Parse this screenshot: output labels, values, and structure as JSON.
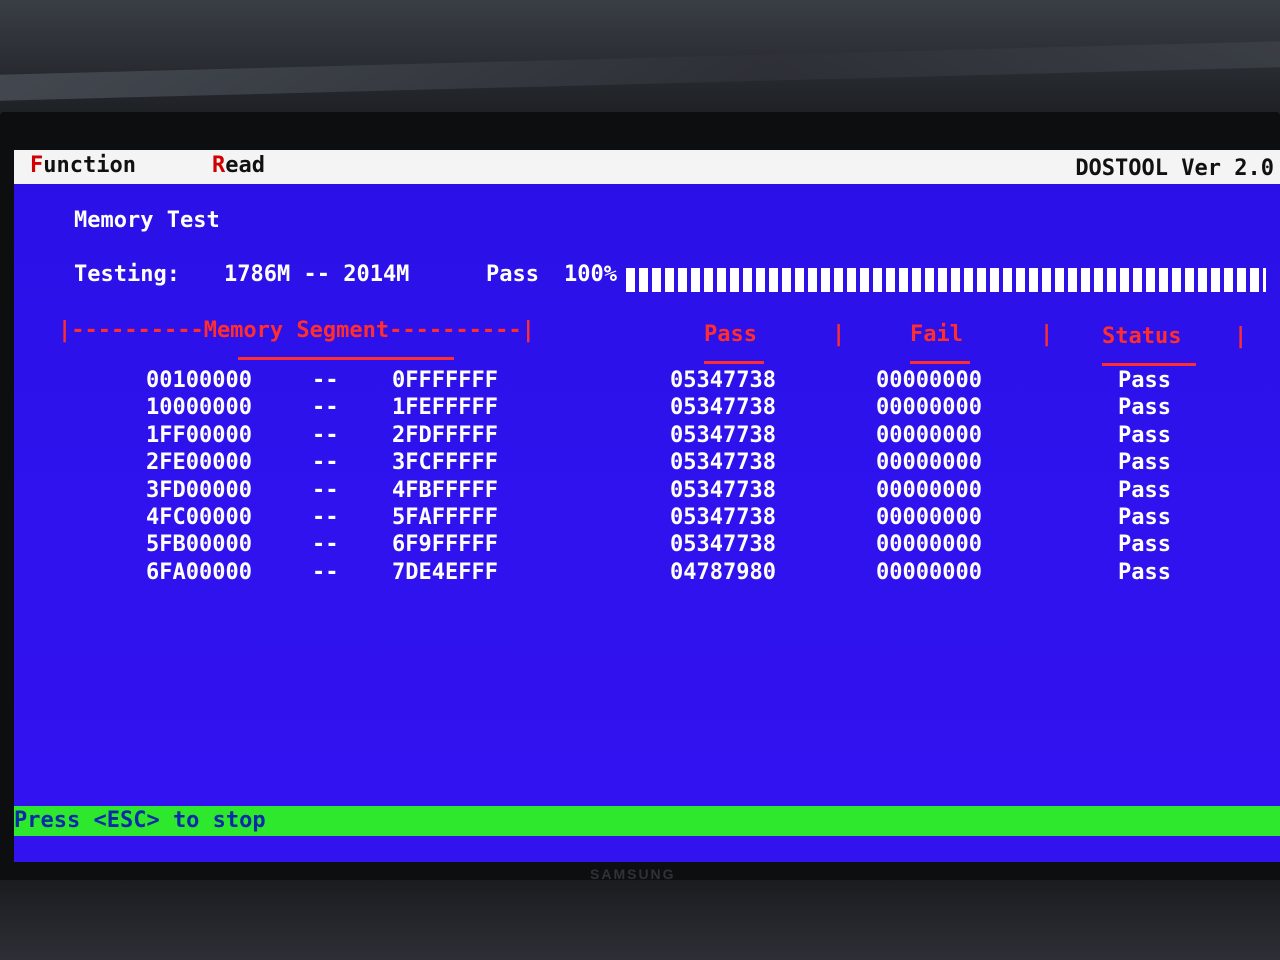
{
  "menubar": {
    "function_hot": "F",
    "function_rest": "unction",
    "read_hot": "R",
    "read_rest": "ead",
    "version": "DOSTOOL Ver 2.0"
  },
  "test": {
    "title": "Memory Test",
    "testing_label": "Testing:",
    "range": "1786M -- 2014M",
    "pass_label": "Pass",
    "progress_text": "100%",
    "progress_fraction": 1.0
  },
  "table": {
    "headers": {
      "segment": "|----------Memory Segment----------|",
      "pass": "Pass",
      "fail": "Fail",
      "status": "Status"
    },
    "separator": "|",
    "range_sep": "--",
    "rows": [
      {
        "start": "00100000",
        "end": "0FFFFFFF",
        "pass": "05347738",
        "fail": "00000000",
        "status": "Pass"
      },
      {
        "start": "10000000",
        "end": "1FEFFFFF",
        "pass": "05347738",
        "fail": "00000000",
        "status": "Pass"
      },
      {
        "start": "1FF00000",
        "end": "2FDFFFFF",
        "pass": "05347738",
        "fail": "00000000",
        "status": "Pass"
      },
      {
        "start": "2FE00000",
        "end": "3FCFFFFF",
        "pass": "05347738",
        "fail": "00000000",
        "status": "Pass"
      },
      {
        "start": "3FD00000",
        "end": "4FBFFFFF",
        "pass": "05347738",
        "fail": "00000000",
        "status": "Pass"
      },
      {
        "start": "4FC00000",
        "end": "5FAFFFFF",
        "pass": "05347738",
        "fail": "00000000",
        "status": "Pass"
      },
      {
        "start": "5FB00000",
        "end": "6F9FFFFF",
        "pass": "05347738",
        "fail": "00000000",
        "status": "Pass"
      },
      {
        "start": "6FA00000",
        "end": "7DE4EFFF",
        "pass": "04787980",
        "fail": "00000000",
        "status": "Pass"
      }
    ]
  },
  "statusbar": {
    "hint": "Press <ESC> to stop"
  },
  "monitor": {
    "brand": "SAMSUNG"
  },
  "colors": {
    "screen_bg": "#2f12ee",
    "header_red": "#ff2d2d",
    "status_green": "#2ee82e",
    "text_white": "#ffffff"
  }
}
